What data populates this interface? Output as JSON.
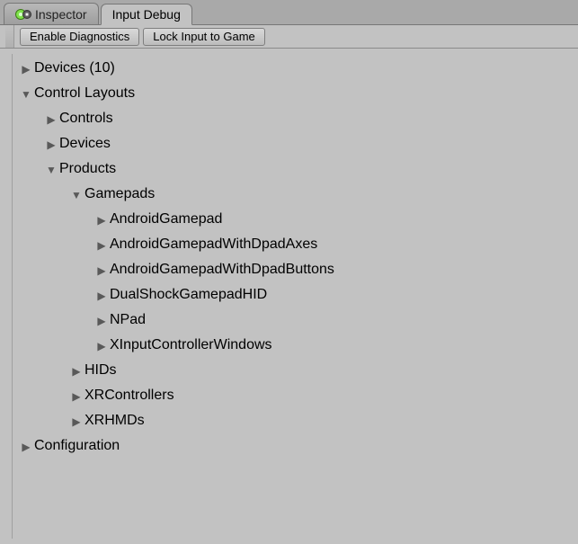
{
  "tabs": {
    "inspector": {
      "label": "Inspector"
    },
    "input_debug": {
      "label": "Input Debug"
    }
  },
  "toolbar": {
    "enable_diagnostics": "Enable Diagnostics",
    "lock_input": "Lock Input to Game"
  },
  "tree": {
    "devices": {
      "label": "Devices (10)"
    },
    "control_layouts": {
      "label": "Control Layouts"
    },
    "controls": {
      "label": "Controls"
    },
    "devices_sub": {
      "label": "Devices"
    },
    "products": {
      "label": "Products"
    },
    "gamepads": {
      "label": "Gamepads"
    },
    "android_gamepad": {
      "label": "AndroidGamepad"
    },
    "android_gamepad_dpad_axes": {
      "label": "AndroidGamepadWithDpadAxes"
    },
    "android_gamepad_dpad_buttons": {
      "label": "AndroidGamepadWithDpadButtons"
    },
    "dualshock": {
      "label": "DualShockGamepadHID"
    },
    "npad": {
      "label": "NPad"
    },
    "xinput": {
      "label": "XInputControllerWindows"
    },
    "hids": {
      "label": "HIDs"
    },
    "xrcontrollers": {
      "label": "XRControllers"
    },
    "xrhmds": {
      "label": "XRHMDs"
    },
    "configuration": {
      "label": "Configuration"
    }
  }
}
